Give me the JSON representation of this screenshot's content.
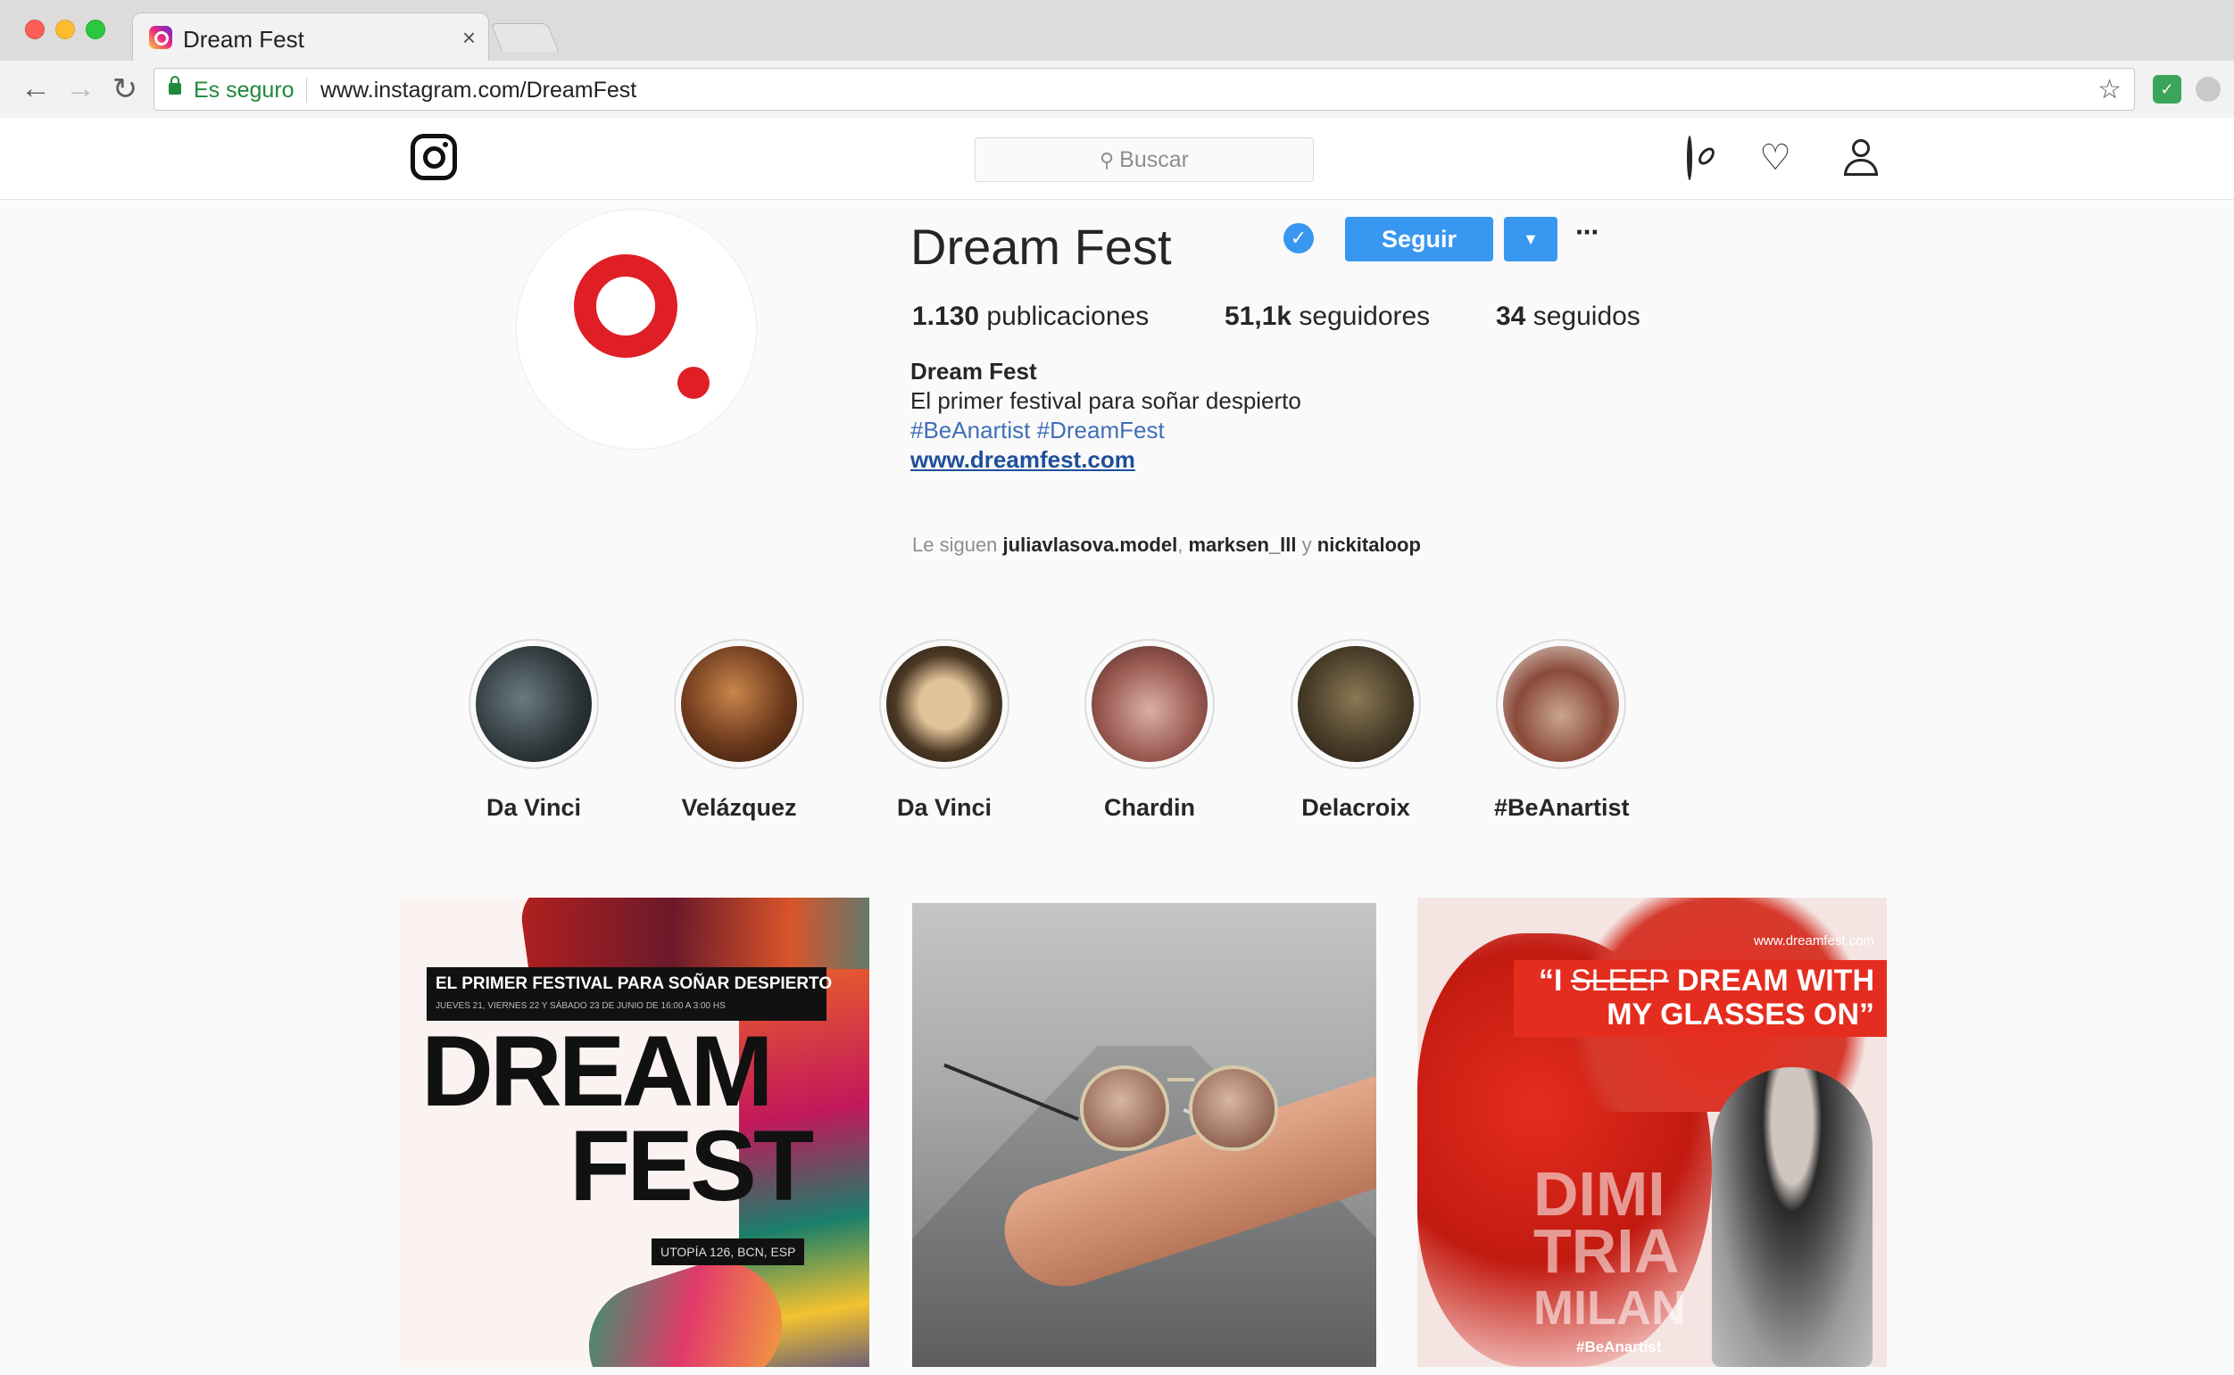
{
  "browser": {
    "tab_title": "Dream Fest",
    "tab_close": "×",
    "secure_label": "Es seguro",
    "url": "www.instagram.com/DreamFest"
  },
  "icons": {
    "back": "arrow-left-icon",
    "forward": "arrow-right-icon",
    "reload": "reload-icon",
    "bookmark": "star-icon",
    "instagram_logo": "instagram-logo-icon",
    "explore": "compass-icon",
    "activity": "heart-icon",
    "profile": "user-icon",
    "verified": "verified-badge-icon"
  },
  "ig": {
    "search_placeholder": "Buscar",
    "profile": {
      "username": "Dream Fest",
      "follow_label": "Seguir",
      "more_label": "···",
      "posts_count": "1.130",
      "posts_label": "publicaciones",
      "followers_count": "51,1k",
      "followers_label": "seguidores",
      "following_count": "34",
      "following_label": "seguidos",
      "bio_name": "Dream Fest",
      "bio_text": "El primer festival para soñar despierto",
      "bio_tags": "#BeAnartist #DreamFest",
      "bio_link": "www.dreamfest.com",
      "followed_by_prefix": "Le siguen",
      "followed_by_1": "juliavlasova.model",
      "followed_by_2": "marksen_lll",
      "followed_by_joiner": "y",
      "followed_by_3": "nickitaloop"
    },
    "highlights": [
      {
        "label": "Da Vinci"
      },
      {
        "label": "Velázquez"
      },
      {
        "label": "Da Vinci"
      },
      {
        "label": "Chardin"
      },
      {
        "label": "Delacroix"
      },
      {
        "label": "#BeAnartist"
      }
    ],
    "posts": {
      "p1_banner_title": "EL PRIMER FESTIVAL PARA SOÑAR DESPIERTO",
      "p1_banner_sub": "JUEVES 21, VIERNES 22 Y SÁBADO 23 DE JUNIO DE 16:00 A 3:00 HS",
      "p1_dream": "DREAM",
      "p1_fest": "FEST",
      "p1_address": "UTOPÍA 126, BCN, ESP",
      "p3_url": "www.dreamfest.com",
      "p3_quote_open": "“I ",
      "p3_quote_strike": "SLEEP",
      "p3_quote_rest": " DREAM WITH MY GLASSES ON”",
      "p3_name_1": "DIMI",
      "p3_name_2": "TRIA",
      "p3_name_3": "MILAN",
      "p3_tag": "#BeAnartist"
    }
  }
}
